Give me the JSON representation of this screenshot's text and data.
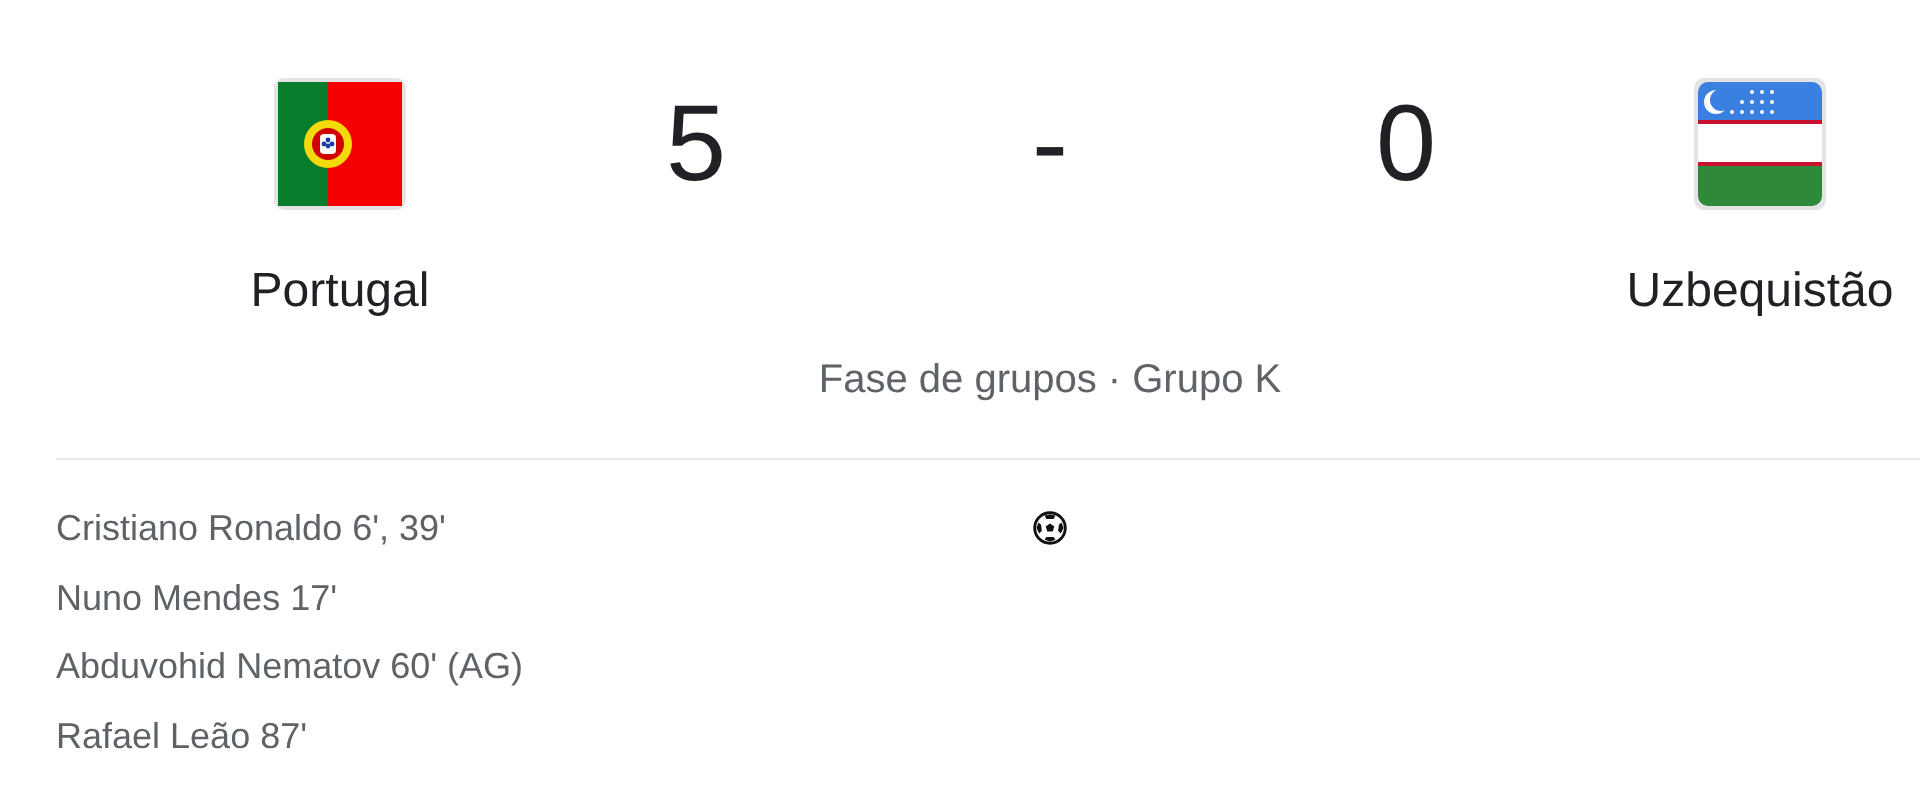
{
  "match": {
    "home": {
      "name": "Portugal",
      "score": "5"
    },
    "separator": "-",
    "away": {
      "name": "Uzbequistão",
      "score": "0"
    },
    "stage": "Fase de grupos · Grupo K"
  },
  "goals": [
    "Cristiano Ronaldo 6', 39'",
    "Nuno Mendes 17'",
    "Abduvohid Nematov 60' (AG)",
    "Rafael Leão 87'"
  ]
}
